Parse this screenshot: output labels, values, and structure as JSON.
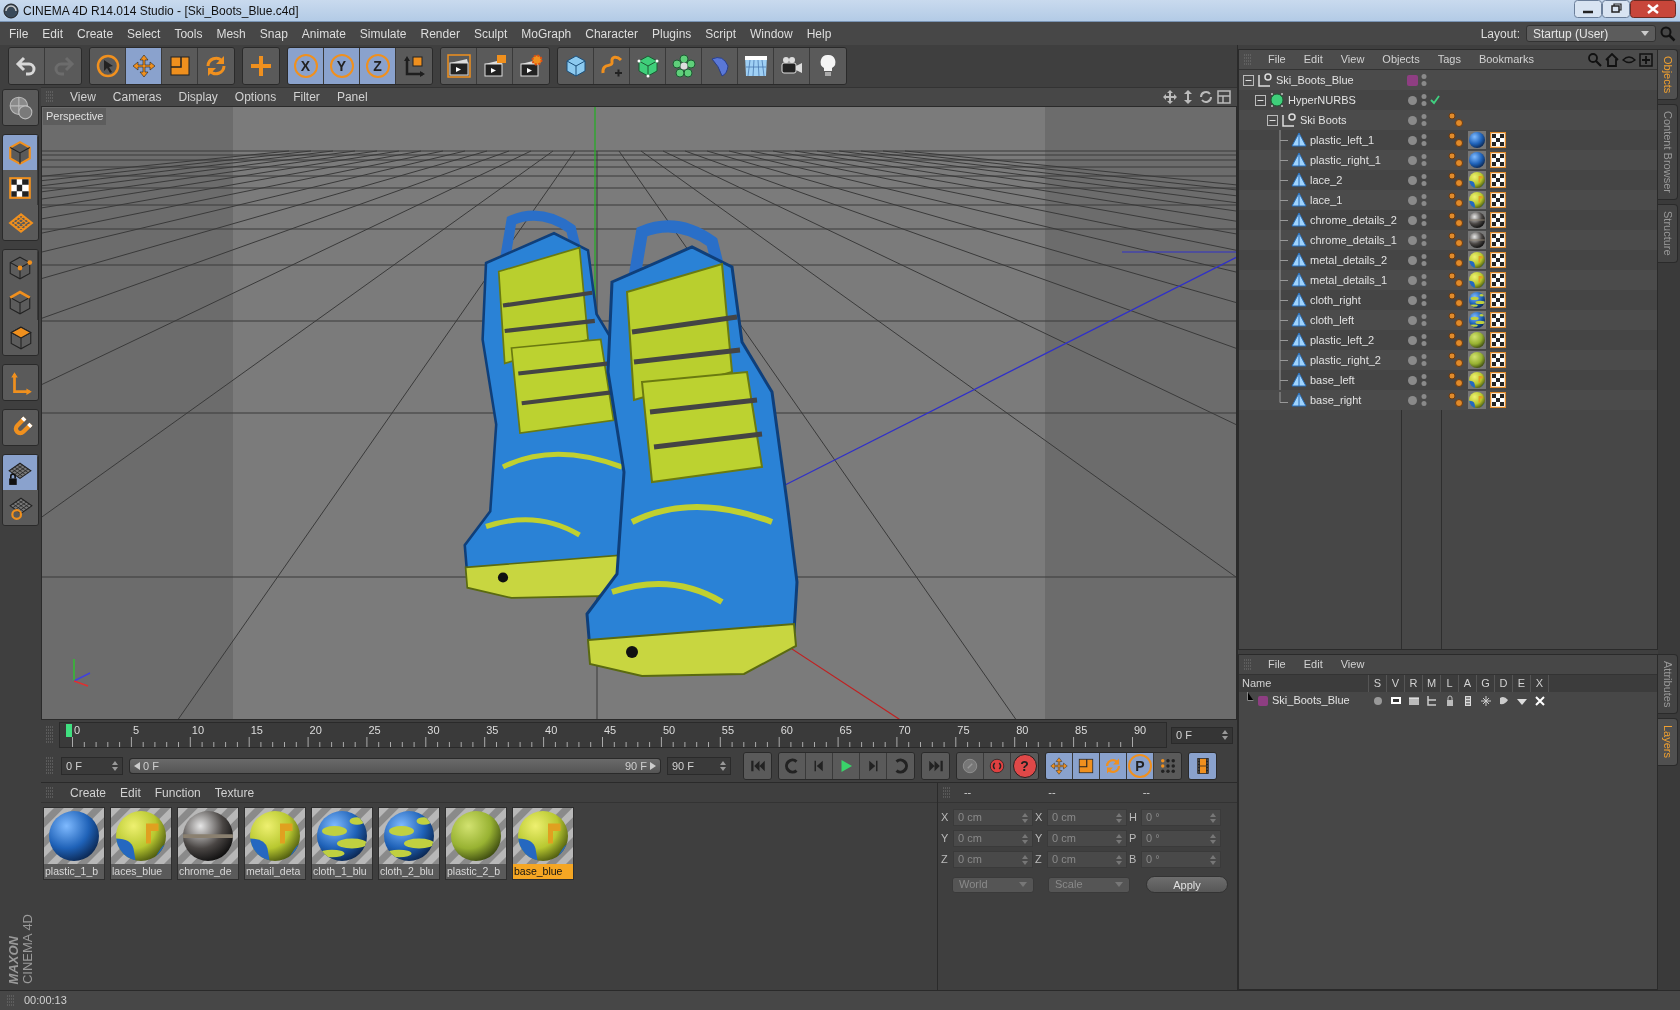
{
  "window": {
    "title": "CINEMA 4D R14.014 Studio - [Ski_Boots_Blue.c4d]"
  },
  "menu_bar": [
    "File",
    "Edit",
    "Create",
    "Select",
    "Tools",
    "Mesh",
    "Snap",
    "Animate",
    "Simulate",
    "Render",
    "Sculpt",
    "MoGraph",
    "Character",
    "Plugins",
    "Script",
    "Window",
    "Help"
  ],
  "layout": {
    "label": "Layout:",
    "value": "Startup (User)"
  },
  "toolbar_groups": [
    {
      "buttons": [
        {
          "kind": "undo",
          "active": false
        },
        {
          "kind": "redo",
          "active": false
        }
      ]
    },
    {
      "buttons": [
        {
          "kind": "select",
          "active": false
        },
        {
          "kind": "move",
          "active": true
        },
        {
          "kind": "scale",
          "active": false
        },
        {
          "kind": "rotate",
          "active": false
        }
      ]
    },
    {
      "buttons": [
        {
          "kind": "add",
          "active": false
        }
      ]
    },
    {
      "buttons": [
        {
          "kind": "axis",
          "label": "X",
          "active": true
        },
        {
          "kind": "axis",
          "label": "Y",
          "active": true
        },
        {
          "kind": "axis",
          "label": "Z",
          "active": true
        },
        {
          "kind": "coord",
          "active": false
        }
      ]
    },
    {
      "buttons": [
        {
          "kind": "render_view",
          "active": false
        },
        {
          "kind": "render",
          "active": false
        },
        {
          "kind": "render_settings",
          "active": false
        }
      ]
    },
    {
      "buttons": [
        {
          "kind": "cube",
          "active": false
        },
        {
          "kind": "spline",
          "active": false
        },
        {
          "kind": "nurbs",
          "active": false
        },
        {
          "kind": "array",
          "active": false
        },
        {
          "kind": "deformer",
          "active": false
        },
        {
          "kind": "floor",
          "active": false
        },
        {
          "kind": "camera",
          "active": false
        },
        {
          "kind": "light",
          "active": false
        }
      ]
    }
  ],
  "mode_tool_groups": [
    {
      "buttons": [
        {
          "kind": "model",
          "active": false
        }
      ]
    },
    {
      "buttons": [
        {
          "kind": "object",
          "active": true
        },
        {
          "kind": "texture",
          "active": false
        },
        {
          "kind": "workplane",
          "active": false
        }
      ]
    },
    {
      "buttons": [
        {
          "kind": "points",
          "active": false
        },
        {
          "kind": "edges",
          "active": false
        },
        {
          "kind": "polygons",
          "active": false
        }
      ]
    },
    {
      "buttons": [
        {
          "kind": "axis_mode",
          "active": false
        }
      ]
    },
    {
      "buttons": [
        {
          "kind": "snap",
          "active": false
        }
      ]
    },
    {
      "buttons": [
        {
          "kind": "lock_workplane",
          "active": true
        },
        {
          "kind": "grid_snap",
          "active": false
        }
      ]
    }
  ],
  "viewport": {
    "menu": [
      "View",
      "Cameras",
      "Display",
      "Options",
      "Filter",
      "Panel"
    ],
    "camera_label": "Perspective"
  },
  "timeline": {
    "ticks": [
      "0",
      "5",
      "10",
      "15",
      "20",
      "25",
      "30",
      "35",
      "40",
      "45",
      "50",
      "55",
      "60",
      "65",
      "70",
      "75",
      "80",
      "85",
      "90"
    ],
    "playhead": {
      "level": 0
    },
    "current_frame": "0 F",
    "start": "0 F",
    "range": {
      "start": "0 F",
      "end": "90 F",
      "level": 1
    },
    "end": "90 F",
    "control_groups": [
      {
        "buttons": [
          {
            "kind": "first",
            "active": false
          }
        ]
      },
      {
        "buttons": [
          {
            "kind": "prev_key",
            "active": false
          },
          {
            "kind": "prev",
            "active": false
          },
          {
            "kind": "play",
            "active": false
          },
          {
            "kind": "next",
            "active": false
          },
          {
            "kind": "next_key",
            "active": false
          }
        ]
      },
      {
        "buttons": [
          {
            "kind": "last",
            "active": false
          }
        ]
      },
      {
        "buttons": [
          {
            "kind": "record",
            "active": false
          },
          {
            "kind": "autokey",
            "active": false
          },
          {
            "kind": "help",
            "label": "?",
            "active": false
          }
        ]
      },
      {
        "buttons": [
          {
            "kind": "move",
            "active": true
          },
          {
            "kind": "scale",
            "active": true
          },
          {
            "kind": "rotate",
            "active": true
          },
          {
            "kind": "param",
            "label": "P",
            "active": true
          },
          {
            "kind": "points_grid",
            "active": false
          }
        ]
      },
      {
        "buttons": [
          {
            "kind": "film",
            "active": true
          }
        ]
      }
    ]
  },
  "materials": {
    "menu": [
      "Create",
      "Edit",
      "Function",
      "Texture"
    ],
    "items": [
      {
        "label": "plastic_1_b",
        "kind": "blue",
        "selected": false
      },
      {
        "label": "laces_blue",
        "kind": "yellow_blue",
        "selected": false
      },
      {
        "label": "chrome_de",
        "kind": "chrome",
        "selected": false
      },
      {
        "label": "metail_deta",
        "kind": "yellow_blue",
        "selected": false
      },
      {
        "label": "cloth_1_blu",
        "kind": "cloth",
        "selected": false
      },
      {
        "label": "cloth_2_blu",
        "kind": "cloth",
        "selected": false
      },
      {
        "label": "plastic_2_b",
        "kind": "green",
        "selected": false
      },
      {
        "label": "base_blue",
        "kind": "yellow_blue",
        "selected": true
      }
    ]
  },
  "coordinates": {
    "disabled": true,
    "headers": [
      "--",
      "--",
      "--"
    ],
    "columns": [
      {
        "fields": [
          {
            "axis": "X",
            "value": "0 cm"
          },
          {
            "axis": "Y",
            "value": "0 cm"
          },
          {
            "axis": "Z",
            "value": "0 cm"
          }
        ]
      },
      {
        "fields": [
          {
            "axis": "X",
            "value": "0 cm"
          },
          {
            "axis": "Y",
            "value": "0 cm"
          },
          {
            "axis": "Z",
            "value": "0 cm"
          }
        ]
      },
      {
        "fields": [
          {
            "axis": "H",
            "value": "0 °"
          },
          {
            "axis": "P",
            "value": "0 °"
          },
          {
            "axis": "B",
            "value": "0 °"
          }
        ]
      }
    ],
    "space": "World",
    "mode": "Scale",
    "apply": "Apply"
  },
  "objects": {
    "menu": [
      "File",
      "Edit",
      "View",
      "Objects",
      "Tags",
      "Bookmarks"
    ],
    "tree": [
      {
        "name": "Ski_Boots_Blue",
        "kind": "null",
        "expanded": true,
        "color": "#8e3e82",
        "children": [
          {
            "name": "HyperNURBS",
            "kind": "nurbs",
            "expanded": true,
            "enabled": true,
            "children": [
              {
                "name": "Ski Boots",
                "kind": "null",
                "expanded": true,
                "tags": [
                  {
                    "kind": "phong"
                  }
                ],
                "children": [
                  {
                    "name": "plastic_left_1",
                    "kind": "polygon",
                    "tags": [
                      {
                        "kind": "phong"
                      },
                      {
                        "kind": "material_blue"
                      },
                      {
                        "kind": "uvw"
                      }
                    ]
                  },
                  {
                    "name": "plastic_right_1",
                    "kind": "polygon",
                    "tags": [
                      {
                        "kind": "phong"
                      },
                      {
                        "kind": "material_blue"
                      },
                      {
                        "kind": "uvw"
                      }
                    ]
                  },
                  {
                    "name": "lace_2",
                    "kind": "polygon",
                    "tags": [
                      {
                        "kind": "phong"
                      },
                      {
                        "kind": "material_yellow_blue"
                      },
                      {
                        "kind": "uvw"
                      }
                    ]
                  },
                  {
                    "name": "lace_1",
                    "kind": "polygon",
                    "tags": [
                      {
                        "kind": "phong"
                      },
                      {
                        "kind": "material_yellow_blue"
                      },
                      {
                        "kind": "uvw"
                      }
                    ]
                  },
                  {
                    "name": "chrome_details_2",
                    "kind": "polygon",
                    "tags": [
                      {
                        "kind": "phong"
                      },
                      {
                        "kind": "material_chrome"
                      },
                      {
                        "kind": "uvw"
                      }
                    ]
                  },
                  {
                    "name": "chrome_details_1",
                    "kind": "polygon",
                    "tags": [
                      {
                        "kind": "phong"
                      },
                      {
                        "kind": "material_chrome"
                      },
                      {
                        "kind": "uvw"
                      }
                    ]
                  },
                  {
                    "name": "metal_details_2",
                    "kind": "polygon",
                    "tags": [
                      {
                        "kind": "phong"
                      },
                      {
                        "kind": "material_yellow_blue"
                      },
                      {
                        "kind": "uvw"
                      }
                    ]
                  },
                  {
                    "name": "metal_details_1",
                    "kind": "polygon",
                    "tags": [
                      {
                        "kind": "phong"
                      },
                      {
                        "kind": "material_yellow_blue"
                      },
                      {
                        "kind": "uvw"
                      }
                    ]
                  },
                  {
                    "name": "cloth_right",
                    "kind": "polygon",
                    "tags": [
                      {
                        "kind": "phong"
                      },
                      {
                        "kind": "material_cloth"
                      },
                      {
                        "kind": "uvw"
                      }
                    ]
                  },
                  {
                    "name": "cloth_left",
                    "kind": "polygon",
                    "tags": [
                      {
                        "kind": "phong"
                      },
                      {
                        "kind": "material_cloth"
                      },
                      {
                        "kind": "uvw"
                      }
                    ]
                  },
                  {
                    "name": "plastic_left_2",
                    "kind": "polygon",
                    "tags": [
                      {
                        "kind": "phong"
                      },
                      {
                        "kind": "material_green"
                      },
                      {
                        "kind": "uvw"
                      }
                    ]
                  },
                  {
                    "name": "plastic_right_2",
                    "kind": "polygon",
                    "tags": [
                      {
                        "kind": "phong"
                      },
                      {
                        "kind": "material_green"
                      },
                      {
                        "kind": "uvw"
                      }
                    ]
                  },
                  {
                    "name": "base_left",
                    "kind": "polygon",
                    "tags": [
                      {
                        "kind": "phong"
                      },
                      {
                        "kind": "material_yellow_blue"
                      },
                      {
                        "kind": "uvw"
                      }
                    ]
                  },
                  {
                    "name": "base_right",
                    "kind": "polygon",
                    "tags": [
                      {
                        "kind": "phong"
                      },
                      {
                        "kind": "material_yellow_blue"
                      },
                      {
                        "kind": "uvw"
                      }
                    ]
                  }
                ]
              }
            ]
          }
        ]
      }
    ]
  },
  "layers": {
    "menu": [
      "File",
      "Edit",
      "View"
    ],
    "columns": [
      "Name",
      "S",
      "V",
      "R",
      "M",
      "L",
      "A",
      "G",
      "D",
      "E",
      "X"
    ],
    "rows": [
      {
        "name": "Ski_Boots_Blue",
        "color": "#8e3e82"
      }
    ]
  },
  "side_tabs_top": [
    {
      "label": "Objects",
      "selected": true
    },
    {
      "label": "Content Browser",
      "selected": false
    },
    {
      "label": "Structure",
      "selected": false
    }
  ],
  "side_tabs_bottom": [
    {
      "label": "Attributes",
      "selected": false
    },
    {
      "label": "Layers",
      "selected": true
    }
  ],
  "logo": {
    "brand": "MAXON",
    "product": "CINEMA 4D"
  },
  "status_bar": {
    "time": "00:00:13"
  }
}
